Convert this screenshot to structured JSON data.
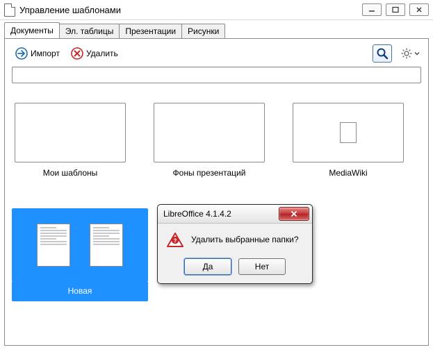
{
  "window": {
    "title": "Управление шаблонами"
  },
  "tabs": [
    {
      "label": "Документы",
      "active": true
    },
    {
      "label": "Эл. таблицы",
      "active": false
    },
    {
      "label": "Презентации",
      "active": false
    },
    {
      "label": "Рисунки",
      "active": false
    }
  ],
  "toolbar": {
    "import_label": "Импорт",
    "delete_label": "Удалить"
  },
  "filter": {
    "value": ""
  },
  "folders_row1": [
    {
      "label": "Мои шаблоны",
      "has_page_thumb": false
    },
    {
      "label": "Фоны презентаций",
      "has_page_thumb": false
    },
    {
      "label": "MediaWiki",
      "has_page_thumb": true
    }
  ],
  "folders_row2": [
    {
      "label": "Новая",
      "selected": true
    }
  ],
  "dialog": {
    "title": "LibreOffice 4.1.4.2",
    "message": "Удалить выбранные папки?",
    "yes_label": "Да",
    "no_label": "Нет"
  }
}
